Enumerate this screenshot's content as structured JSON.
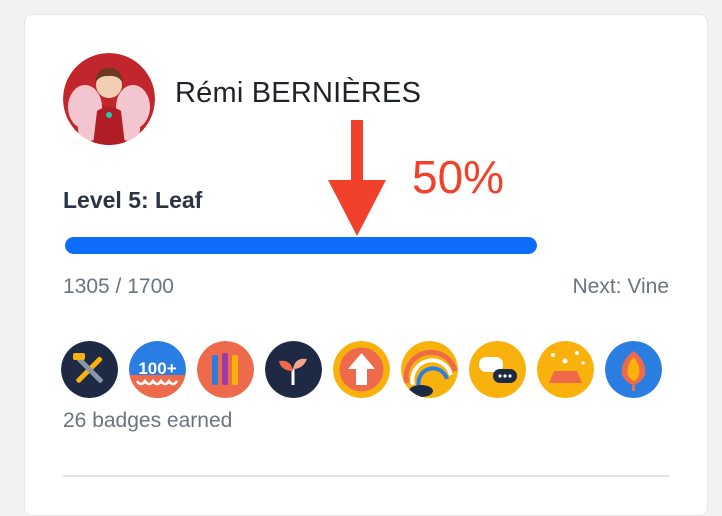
{
  "profile": {
    "name": "Rémi BERNIÈRES",
    "avatar_icon": "avatar-fairy-illustration"
  },
  "level": {
    "title": "Level 5: Leaf",
    "current_xp": 1305,
    "target_xp": 1700,
    "xp_text": "1305 / 1700",
    "next_text": "Next: Vine",
    "progress_fraction": 1.0,
    "bar_color": "#0d6efd"
  },
  "annotation": {
    "label": "50%",
    "color": "#f2412b"
  },
  "badges": {
    "items": [
      {
        "icon": "tools-badge-icon",
        "bg": "#1e2a44"
      },
      {
        "icon": "100-plus-badge-icon",
        "bg": "#2a7de1"
      },
      {
        "icon": "pencils-badge-icon",
        "bg": "#ef6a4a"
      },
      {
        "icon": "sprout-badge-icon",
        "bg": "#1e2a44"
      },
      {
        "icon": "upvote-arrow-badge-icon",
        "bg": "#f9b20b"
      },
      {
        "icon": "rainbow-badge-icon",
        "bg": "#f9b20b"
      },
      {
        "icon": "chat-bubbles-badge-icon",
        "bg": "#f9b20b"
      },
      {
        "icon": "celebration-badge-icon",
        "bg": "#f9b20b"
      },
      {
        "icon": "autumn-leaf-badge-icon",
        "bg": "#2a7de1"
      }
    ],
    "earned_text": "26 badges earned"
  }
}
